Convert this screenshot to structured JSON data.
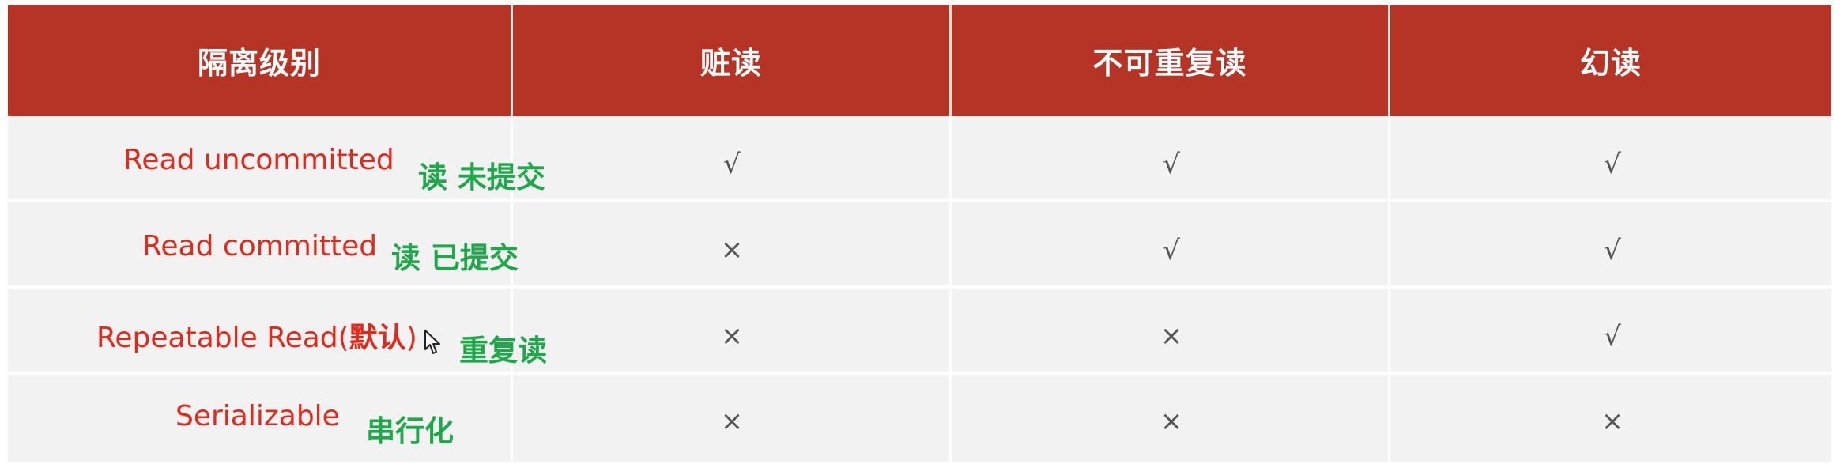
{
  "headers": [
    "隔离级别",
    "赃读",
    "不可重复读",
    "幻读"
  ],
  "rows": [
    {
      "level_en": "Read uncommitted",
      "level_cn": "读 未提交",
      "dirty_read": "√",
      "non_repeatable_read": "√",
      "phantom_read": "√"
    },
    {
      "level_en": "Read committed",
      "level_cn": "读 已提交",
      "dirty_read": "×",
      "non_repeatable_read": "√",
      "phantom_read": "√"
    },
    {
      "level_en": "Repeatable Read(",
      "level_en_default": "默认",
      "level_en_close": ")",
      "level_cn": "重复读",
      "dirty_read": "×",
      "non_repeatable_read": "×",
      "phantom_read": "√"
    },
    {
      "level_en": "Serializable",
      "level_cn": "串行化",
      "dirty_read": "×",
      "non_repeatable_read": "×",
      "phantom_read": "×"
    }
  ],
  "colors": {
    "header_bg": "#b53426",
    "header_text": "#ffffff",
    "row_bg": "#f2f2f2",
    "level_en_text": "#e02a1b",
    "level_cn_text": "#1fa84a",
    "mark_text": "#555555"
  },
  "icons": {
    "cursor": "mouse-pointer-icon"
  }
}
